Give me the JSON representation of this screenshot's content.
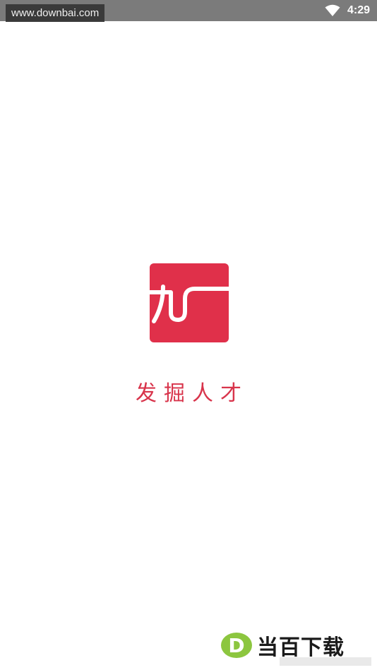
{
  "status_bar": {
    "watermark_url": "www.downbai.com",
    "time": "4:29",
    "background": "#7b7b7b",
    "icons": [
      "wifi-icon"
    ]
  },
  "splash": {
    "logo_glyph": "九一",
    "slogan": "发掘人才",
    "brand_color": "#e0304a"
  },
  "watermark": {
    "letter": "D",
    "text": "当百下载",
    "icon_color": "#8cc63f"
  }
}
